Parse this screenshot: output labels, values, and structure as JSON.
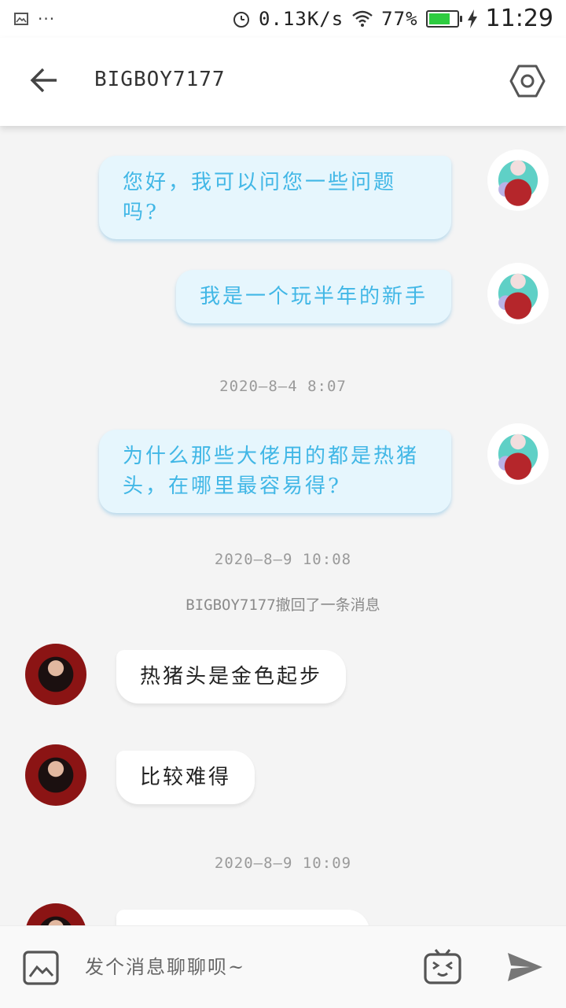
{
  "status_bar": {
    "network_speed": "0.13K/s",
    "battery_percent": "77%",
    "battery_level": 0.77,
    "time": "11:29",
    "icons": [
      "image-icon",
      "more-dots-icon",
      "alarm-icon",
      "wifi-icon",
      "battery-icon",
      "charging-icon"
    ]
  },
  "header": {
    "title": "BIGBOY7177",
    "back_icon": "back-arrow-icon",
    "settings_icon": "hexagon-settings-icon"
  },
  "messages": [
    {
      "type": "out",
      "text": "您好，我可以问您一些问题吗?"
    },
    {
      "type": "out",
      "text": "我是一个玩半年的新手"
    },
    {
      "type": "timestamp",
      "text": "2020—8—4 8:07"
    },
    {
      "type": "out",
      "text": "为什么那些大佬用的都是热猪头，在哪里最容易得?"
    },
    {
      "type": "timestamp",
      "text": "2020—8—9 10:08"
    },
    {
      "type": "system",
      "text": "BIGBOY7177撤回了一条消息"
    },
    {
      "type": "in",
      "text": "热猪头是金色起步"
    },
    {
      "type": "in",
      "text": "比较难得"
    },
    {
      "type": "timestamp",
      "text": "2020—8—9 10:09"
    }
  ],
  "input_bar": {
    "placeholder": "发个消息聊聊呗~",
    "image_icon": "image-picker-icon",
    "emoji_icon": "emoji-face-icon",
    "send_icon": "send-icon"
  },
  "colors": {
    "outgoing_bubble_bg": "#e6f6fd",
    "outgoing_text": "#41b7e6",
    "incoming_bubble_bg": "#ffffff",
    "background": "#f4f4f4"
  }
}
